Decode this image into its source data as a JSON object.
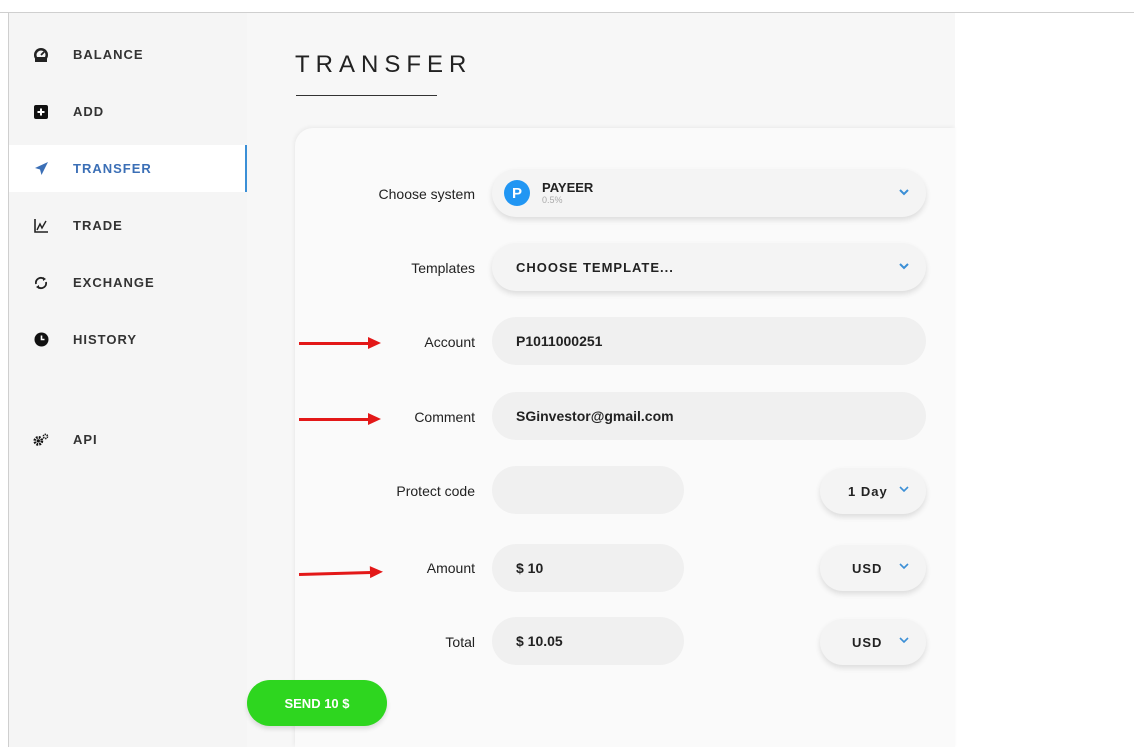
{
  "sidebar": {
    "items": [
      {
        "label": "BALANCE",
        "icon": "gauge-icon"
      },
      {
        "label": "ADD",
        "icon": "plus-square-icon"
      },
      {
        "label": "TRANSFER",
        "icon": "paper-plane-icon",
        "active": true
      },
      {
        "label": "TRADE",
        "icon": "chart-line-icon"
      },
      {
        "label": "EXCHANGE",
        "icon": "refresh-icon"
      },
      {
        "label": "HISTORY",
        "icon": "clock-icon"
      },
      {
        "label": "API",
        "icon": "gears-icon"
      }
    ]
  },
  "page": {
    "title": "TRANSFER"
  },
  "form": {
    "system": {
      "label": "Choose system",
      "name": "PAYEER",
      "fee": "0.5%",
      "logo_letter": "P"
    },
    "templates": {
      "label": "Templates",
      "value": "CHOOSE TEMPLATE..."
    },
    "account": {
      "label": "Account",
      "value": "P1011000251"
    },
    "comment": {
      "label": "Comment",
      "value": "SGinvestor@gmail.com"
    },
    "protect": {
      "label": "Protect code",
      "value": "",
      "period": "1 Day"
    },
    "amount": {
      "label": "Amount",
      "value": "$ 10",
      "currency": "USD"
    },
    "total": {
      "label": "Total",
      "value": "$ 10.05",
      "currency": "USD"
    },
    "send_label": "SEND 10 $"
  },
  "colors": {
    "accent": "#3b8fd6",
    "send": "#2ed61f",
    "arrow": "#e31818",
    "payeer": "#2196f3"
  }
}
